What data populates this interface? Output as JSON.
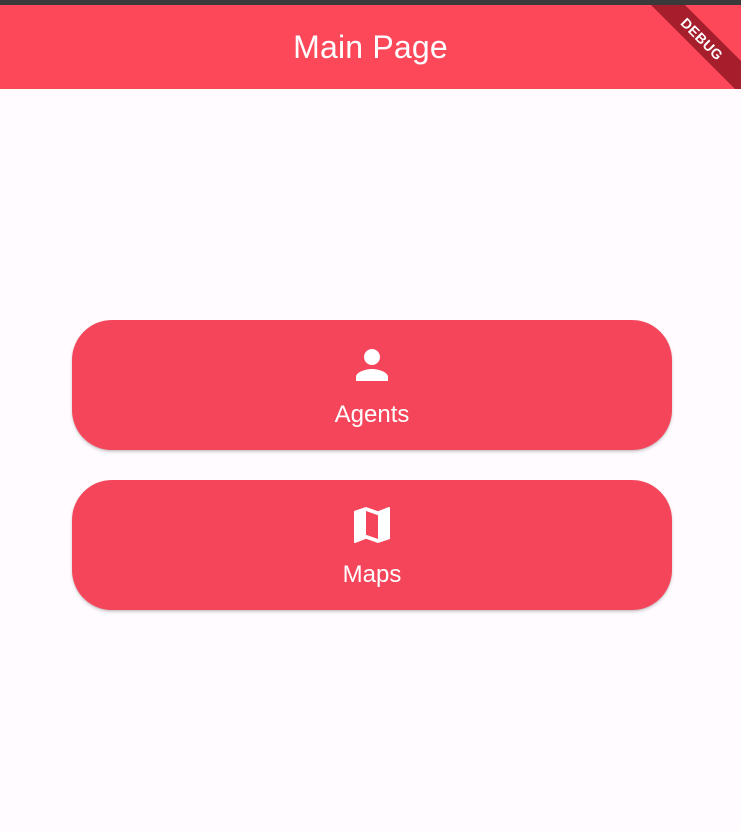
{
  "appbar": {
    "title": "Main Page",
    "debug_label": "DEBUG"
  },
  "buttons": [
    {
      "label": "Agents",
      "icon": "person-icon"
    },
    {
      "label": "Maps",
      "icon": "map-icon"
    }
  ],
  "colors": {
    "appbar": "#fd485a",
    "button": "#f5455b",
    "background": "#fffbfe",
    "debug_ribbon": "#a61d2c",
    "status_strip": "#3a3a3a"
  }
}
